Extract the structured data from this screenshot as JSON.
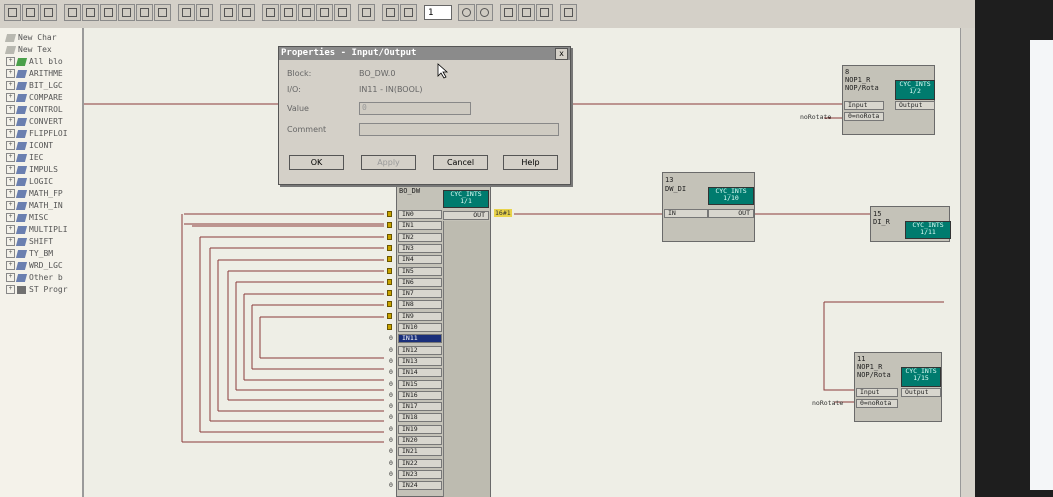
{
  "dialog": {
    "title": "Properties - Input/Output",
    "close_glyph": "x",
    "block_label": "Block:",
    "block_value": "BO_DW.0",
    "io_label": "I/O:",
    "io_value": "IN11 - IN(BOOL)",
    "value_label": "Value",
    "value_value": "0",
    "comment_label": "Comment",
    "comment_value": "",
    "ok": "OK",
    "apply": "Apply",
    "cancel": "Cancel",
    "help": "Help"
  },
  "toolbar": {
    "zoom_value": "1"
  },
  "sidebar": {
    "items": [
      "New Char",
      "New Tex",
      "All blo",
      "ARITHME",
      "BIT_LGC",
      "COMPARE",
      "CONTROL",
      "CONVERT",
      "FLIPFLOI",
      "ICONT",
      "IEC",
      "IMPULS",
      "LOGIC",
      "MATH_FP",
      "MATH_IN",
      "MISC",
      "MULTIPLI",
      "SHIFT",
      "TY_BM",
      "WRD_LGC",
      "Other b",
      "ST Progr"
    ]
  },
  "main_block": {
    "name": "BO_DW",
    "cyc_line1": "CYC_INTS",
    "cyc_line2": "1/1",
    "out_label": "OUT",
    "out_wire": "16#1",
    "inputs": [
      "IN0",
      "IN1",
      "IN2",
      "IN3",
      "IN4",
      "IN5",
      "IN6",
      "IN7",
      "IN8",
      "IN9",
      "IN10",
      "IN11",
      "IN12",
      "IN13",
      "IN14",
      "IN15",
      "IN16",
      "IN17",
      "IN18",
      "IN19",
      "IN20",
      "IN21",
      "IN22",
      "IN23",
      "IN24"
    ],
    "input_zero": "0"
  },
  "dw_block": {
    "num": "13",
    "name": "DW_DI",
    "cyc_line1": "CYC_INTS",
    "cyc_line2": "1/10",
    "in_label": "IN",
    "out_label": "OUT"
  },
  "di_block": {
    "num": "15",
    "name": "DI_R",
    "cyc_line1": "CYC_INTS",
    "cyc_line2": "1/11"
  },
  "nop_top": {
    "num": "8",
    "name1": "NOP1_R",
    "name2": "NOP/Rota",
    "cyc_line1": "CYC_INTS",
    "cyc_line2": "1/2",
    "pin_input": "Input",
    "pin_output": "Output",
    "pin_norot": "0=noRota",
    "wire_label": "noRotate"
  },
  "nop_bottom": {
    "num": "11",
    "name1": "NOP1_R",
    "name2": "NOP/Rota",
    "cyc_line1": "CYC_INTS",
    "cyc_line2": "1/15",
    "pin_input": "Input",
    "pin_output": "Output",
    "pin_norot": "0=noRota",
    "wire_label": "noRotate"
  },
  "colors": {
    "cyc_header": "#007b6e",
    "selected_pin": "#1a2f7a",
    "wire": "#8b3a3a",
    "bool_marker": "#c8a400"
  }
}
